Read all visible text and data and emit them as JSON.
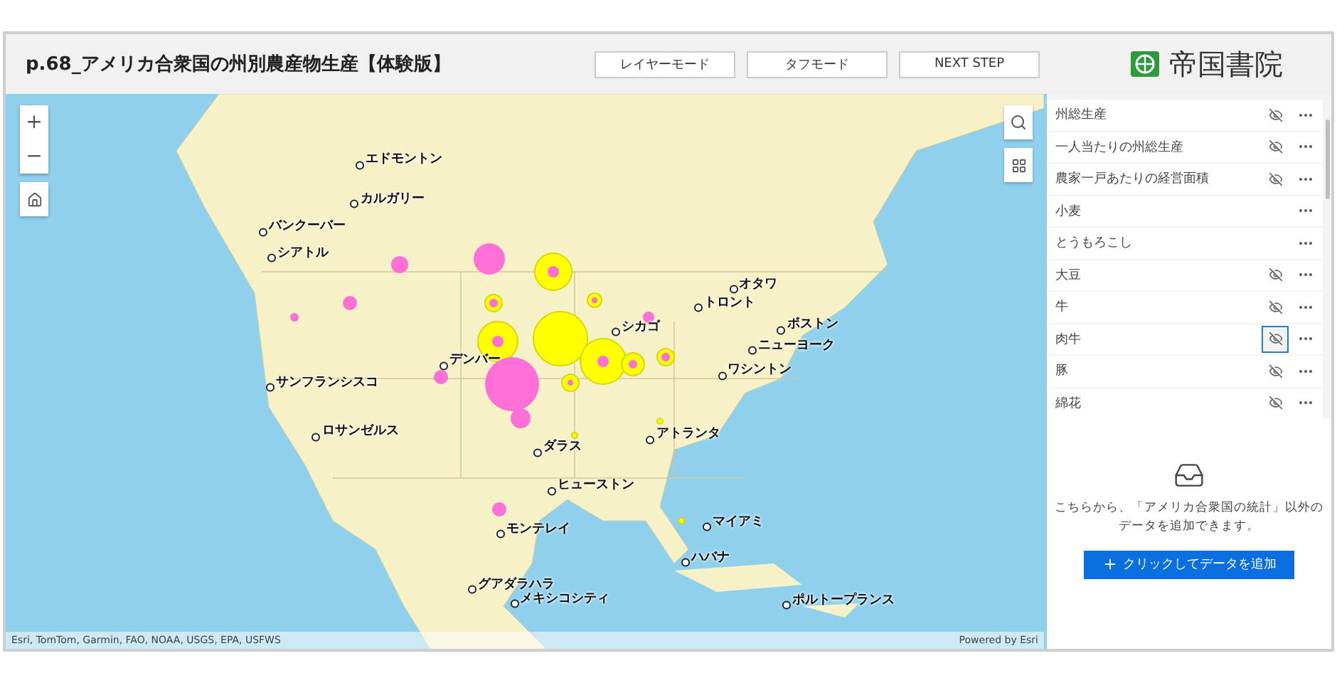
{
  "header": {
    "title": "p.68_アメリカ合衆国の州別農産物生産【体験版】",
    "buttons": [
      "レイヤーモード",
      "タフモード",
      "NEXT STEP"
    ],
    "logo": "帝国書院"
  },
  "map": {
    "zoom_in": "+",
    "zoom_out": "−",
    "cities": [
      "エドモントン",
      "カルガリー",
      "バンクーバー",
      "シアトル",
      "サンフランシスコ",
      "ロサンゼルス",
      "デンバー",
      "シカゴ",
      "オタワ",
      "トロント",
      "ボストン",
      "ニューヨーク",
      "ワシントン",
      "アトランタ",
      "ダラス",
      "ヒューストン",
      "モンテレイ",
      "マイアミ",
      "ハバナ",
      "グアダラハラ",
      "メキシコシティ",
      "ポルトープランス"
    ],
    "attribution": "Esri, TomTom, Garmin, FAO, NOAA, USGS, EPA, USFWS",
    "powered_by": "Powered by Esri"
  },
  "layers": [
    {
      "name": "州総生産",
      "visibility_toggle": true,
      "focused": false
    },
    {
      "name": "一人当たりの州総生産",
      "visibility_toggle": true,
      "focused": false
    },
    {
      "name": "農家一戸あたりの経営面積",
      "visibility_toggle": true,
      "focused": false
    },
    {
      "name": "小麦",
      "visibility_toggle": false,
      "focused": false
    },
    {
      "name": "とうもろこし",
      "visibility_toggle": false,
      "focused": false
    },
    {
      "name": "大豆",
      "visibility_toggle": true,
      "focused": false
    },
    {
      "name": "牛",
      "visibility_toggle": true,
      "focused": false
    },
    {
      "name": "肉牛",
      "visibility_toggle": true,
      "focused": true
    },
    {
      "name": "豚",
      "visibility_toggle": true,
      "focused": false
    },
    {
      "name": "綿花",
      "visibility_toggle": true,
      "focused": false
    }
  ],
  "add_data": {
    "message": "こちらから、「アメリカ合衆国の統計」以外のデータを追加できます。",
    "button": "クリックしてデータを追加"
  }
}
